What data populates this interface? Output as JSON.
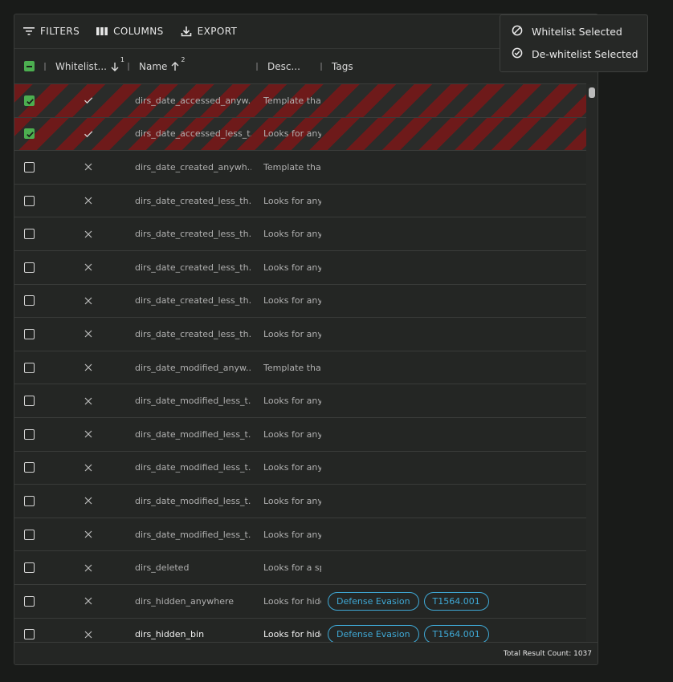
{
  "toolbar": {
    "filters": "FILTERS",
    "columns": "COLUMNS",
    "export": "EXPORT"
  },
  "columns": {
    "whitelist": "Whitelist...",
    "whitelist_sort_index": "1",
    "name": "Name",
    "name_sort_index": "2",
    "description": "Desc...",
    "tags": "Tags"
  },
  "menu": {
    "whitelist_selected": "Whitelist Selected",
    "dewhitelist_selected": "De-whitelist Selected"
  },
  "rows": [
    {
      "selected": true,
      "whitelisted": true,
      "name": "dirs_date_accessed_anyw...",
      "description": "Template tha",
      "tags": []
    },
    {
      "selected": true,
      "whitelisted": true,
      "name": "dirs_date_accessed_less_t...",
      "description": "Looks for any",
      "tags": []
    },
    {
      "selected": false,
      "whitelisted": false,
      "name": "dirs_date_created_anywh...",
      "description": "Template tha",
      "tags": []
    },
    {
      "selected": false,
      "whitelisted": false,
      "name": "dirs_date_created_less_th...",
      "description": "Looks for any",
      "tags": []
    },
    {
      "selected": false,
      "whitelisted": false,
      "name": "dirs_date_created_less_th...",
      "description": "Looks for any",
      "tags": []
    },
    {
      "selected": false,
      "whitelisted": false,
      "name": "dirs_date_created_less_th...",
      "description": "Looks for any",
      "tags": []
    },
    {
      "selected": false,
      "whitelisted": false,
      "name": "dirs_date_created_less_th...",
      "description": "Looks for any",
      "tags": []
    },
    {
      "selected": false,
      "whitelisted": false,
      "name": "dirs_date_created_less_th...",
      "description": "Looks for any",
      "tags": []
    },
    {
      "selected": false,
      "whitelisted": false,
      "name": "dirs_date_modified_anyw...",
      "description": "Template tha",
      "tags": []
    },
    {
      "selected": false,
      "whitelisted": false,
      "name": "dirs_date_modified_less_t...",
      "description": "Looks for any",
      "tags": []
    },
    {
      "selected": false,
      "whitelisted": false,
      "name": "dirs_date_modified_less_t...",
      "description": "Looks for any",
      "tags": []
    },
    {
      "selected": false,
      "whitelisted": false,
      "name": "dirs_date_modified_less_t...",
      "description": "Looks for any",
      "tags": []
    },
    {
      "selected": false,
      "whitelisted": false,
      "name": "dirs_date_modified_less_t...",
      "description": "Looks for any",
      "tags": []
    },
    {
      "selected": false,
      "whitelisted": false,
      "name": "dirs_date_modified_less_t...",
      "description": "Looks for any",
      "tags": []
    },
    {
      "selected": false,
      "whitelisted": false,
      "name": "dirs_deleted",
      "description": "Looks for a sp",
      "tags": []
    },
    {
      "selected": false,
      "whitelisted": false,
      "name": "dirs_hidden_anywhere",
      "description": "Looks for hidd",
      "tags": [
        "Defense Evasion",
        "T1564.001"
      ]
    },
    {
      "selected": false,
      "whitelisted": false,
      "name": "dirs_hidden_bin",
      "description": "Looks for hidd",
      "tags": [
        "Defense Evasion",
        "T1564.001"
      ],
      "bright": true
    }
  ],
  "footer": {
    "total": "Total Result Count: 1037"
  },
  "colors": {
    "background": "#191b19",
    "panel": "#242624",
    "checkbox_accent": "#4caf50",
    "selected_stripe": "#6e1a1a",
    "tag": "#3fa9d6"
  }
}
